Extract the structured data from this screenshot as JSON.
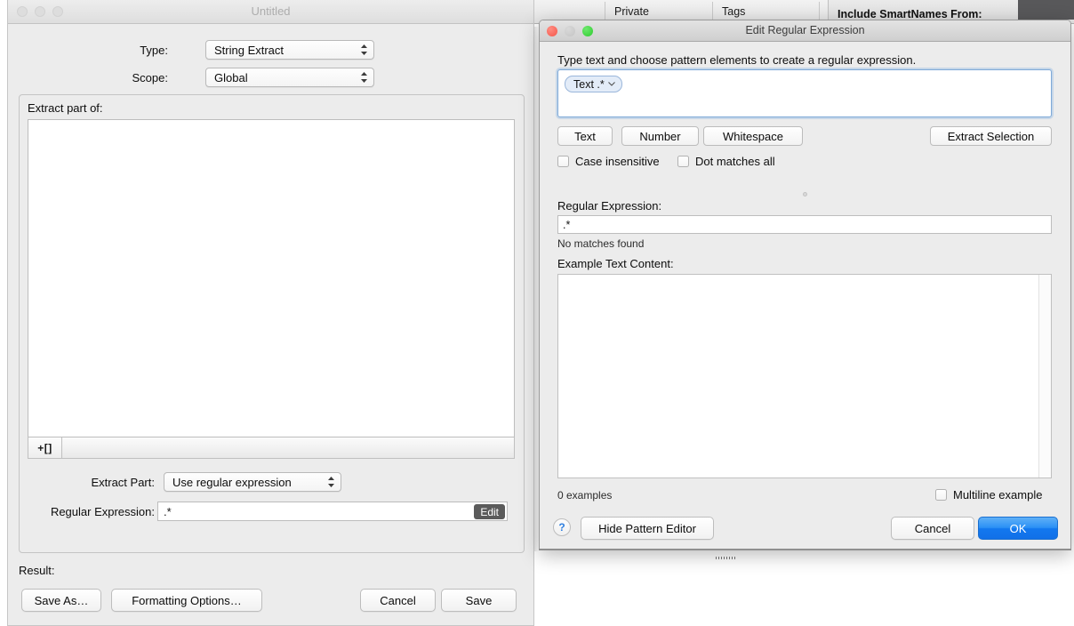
{
  "background_app": {
    "tabs": [
      {
        "label": "Private"
      },
      {
        "label": "Tags"
      }
    ],
    "panel_header": "Include SmartNames From:"
  },
  "left_window": {
    "title": "Untitled",
    "traffic_lights": [
      "close-icon",
      "minimize-icon",
      "zoom-icon"
    ],
    "fields": {
      "type_label": "Type:",
      "type_value": "String Extract",
      "scope_label": "Scope:",
      "scope_value": "Global"
    },
    "group": {
      "title": "Extract part of:",
      "segmented_add_label": "+[]"
    },
    "extract_part_label": "Extract Part:",
    "extract_part_value": "Use regular expression",
    "regular_expression_label": "Regular Expression:",
    "regular_expression_value": ".*",
    "edit_button_label": "Edit",
    "result_label": "Result:",
    "buttons": {
      "save_as": "Save As…",
      "formatting_options": "Formatting Options…",
      "cancel": "Cancel",
      "save": "Save"
    }
  },
  "dialog": {
    "title": "Edit Regular Expression",
    "traffic_lights": [
      "close-icon",
      "minimize-icon",
      "zoom-icon"
    ],
    "instruction": "Type text and choose pattern elements to create a regular expression.",
    "token": {
      "label": "Text .*",
      "chevron": "⌄"
    },
    "pattern_buttons": [
      {
        "label": "Text"
      },
      {
        "label": "Number"
      },
      {
        "label": "Whitespace"
      }
    ],
    "extract_selection_label": "Extract Selection",
    "checkboxes": [
      {
        "label": "Case insensitive",
        "checked": false
      },
      {
        "label": "Dot matches all",
        "checked": false
      }
    ],
    "regex_label": "Regular Expression:",
    "regex_value": ".*",
    "match_status": "No matches found",
    "example_label": "Example Text Content:",
    "example_value": "",
    "examples_count": "0 examples",
    "multiline_label": "Multiline example",
    "help_label": "?",
    "hide_pattern_editor_label": "Hide Pattern Editor",
    "cancel_label": "Cancel",
    "ok_label": "OK"
  },
  "colors": {
    "accent_blue": "#2a90f5",
    "window_bg": "#ececec",
    "focus_ring": "#7ea9d8",
    "edit_btn_bg": "#5b5b5b"
  }
}
